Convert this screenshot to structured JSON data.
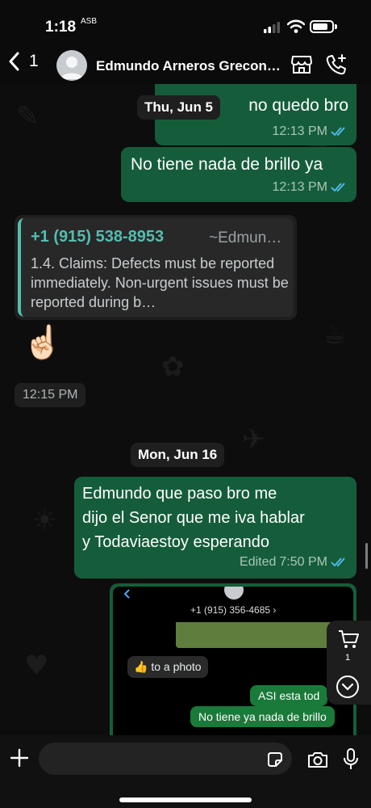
{
  "status_bar": {
    "time": "1:18",
    "sub_label": "ASB"
  },
  "header": {
    "back_count": "1",
    "contact_name": "Edmundo Arneros Greconstructiona"
  },
  "messages": {
    "m1": {
      "text": "no quedo bro",
      "time": "12:13 PM"
    },
    "date1": "Thu, Jun 5",
    "m2": {
      "text": "No tiene nada de brillo ya",
      "time": "12:13 PM"
    },
    "reply": {
      "phone": "+1 (915) 538-8953",
      "author": "~Edmun…",
      "text": "1.4. Claims: Defects must be reported immediately. Non-urgent issues must be reported during b…"
    },
    "emoji": "☝🏻",
    "emoji_time": "12:15 PM",
    "date2": "Mon, Jun 16",
    "m3": {
      "lines": [
        "Edmundo que paso bro me",
        "dijo el Senor que me iva hablar",
        "y Todaviaestoy esperando"
      ],
      "edited_label": "Edited",
      "time": "7:50 PM"
    },
    "media": {
      "phone": "+1 (915) 356-4685 ›",
      "like_text": "👍 to a photo",
      "out1": "ASI esta tod",
      "out2": "No tiene ya nada de brillo"
    }
  },
  "float": {
    "cart_count": "1"
  },
  "composer": {
    "placeholder": ""
  },
  "colors": {
    "bubble_out": "#155d3a",
    "quote_accent": "#53bdb0",
    "read_ticks": "#53bdf0"
  }
}
